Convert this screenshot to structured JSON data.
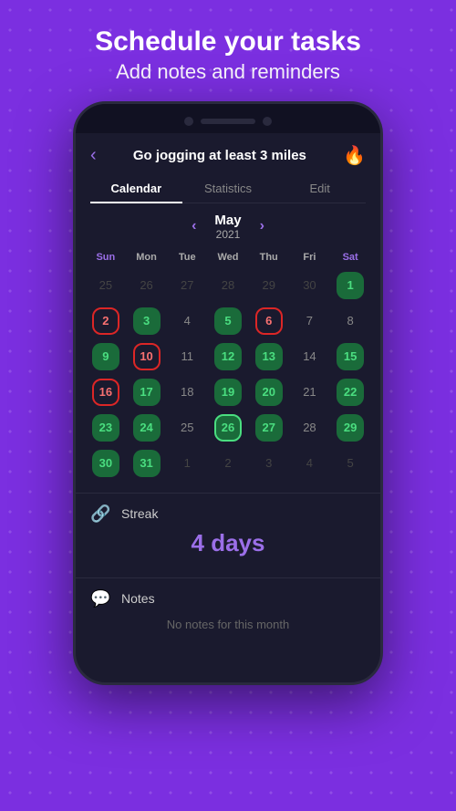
{
  "hero": {
    "title": "Schedule your tasks",
    "subtitle": "Add notes and reminders"
  },
  "phone": {
    "header": {
      "back_icon": "‹",
      "title": "Go jogging at least 3 miles",
      "fire_icon": "🔥"
    },
    "tabs": [
      {
        "label": "Calendar",
        "active": true
      },
      {
        "label": "Statistics",
        "active": false
      },
      {
        "label": "Edit",
        "active": false
      }
    ],
    "calendar": {
      "nav_prev": "‹",
      "nav_next": "›",
      "month": "May",
      "year": "2021",
      "day_headers": [
        {
          "label": "Sun",
          "type": "sun"
        },
        {
          "label": "Mon",
          "type": "weekday"
        },
        {
          "label": "Tue",
          "type": "weekday"
        },
        {
          "label": "Wed",
          "type": "weekday"
        },
        {
          "label": "Thu",
          "type": "weekday"
        },
        {
          "label": "Fri",
          "type": "weekday"
        },
        {
          "label": "Sat",
          "type": "sat"
        }
      ],
      "weeks": [
        [
          {
            "num": "25",
            "type": "other-month"
          },
          {
            "num": "26",
            "type": "other-month"
          },
          {
            "num": "27",
            "type": "other-month"
          },
          {
            "num": "28",
            "type": "other-month"
          },
          {
            "num": "29",
            "type": "other-month"
          },
          {
            "num": "30",
            "type": "other-month"
          },
          {
            "num": "1",
            "type": "green"
          }
        ],
        [
          {
            "num": "2",
            "type": "red"
          },
          {
            "num": "3",
            "type": "green"
          },
          {
            "num": "4",
            "type": "plain"
          },
          {
            "num": "5",
            "type": "green"
          },
          {
            "num": "6",
            "type": "red"
          },
          {
            "num": "7",
            "type": "plain"
          },
          {
            "num": "8",
            "type": "plain"
          }
        ],
        [
          {
            "num": "9",
            "type": "green"
          },
          {
            "num": "10",
            "type": "red"
          },
          {
            "num": "11",
            "type": "plain"
          },
          {
            "num": "12",
            "type": "green"
          },
          {
            "num": "13",
            "type": "green"
          },
          {
            "num": "14",
            "type": "plain"
          },
          {
            "num": "15",
            "type": "green"
          }
        ],
        [
          {
            "num": "16",
            "type": "red"
          },
          {
            "num": "17",
            "type": "green"
          },
          {
            "num": "18",
            "type": "plain"
          },
          {
            "num": "19",
            "type": "green"
          },
          {
            "num": "20",
            "type": "green"
          },
          {
            "num": "21",
            "type": "plain"
          },
          {
            "num": "22",
            "type": "green"
          }
        ],
        [
          {
            "num": "23",
            "type": "green"
          },
          {
            "num": "24",
            "type": "green"
          },
          {
            "num": "25",
            "type": "plain"
          },
          {
            "num": "26",
            "type": "today-green"
          },
          {
            "num": "27",
            "type": "green"
          },
          {
            "num": "28",
            "type": "plain"
          },
          {
            "num": "29",
            "type": "green"
          }
        ],
        [
          {
            "num": "30",
            "type": "green"
          },
          {
            "num": "31",
            "type": "green"
          },
          {
            "num": "1",
            "type": "other-month"
          },
          {
            "num": "2",
            "type": "other-month"
          },
          {
            "num": "3",
            "type": "other-month"
          },
          {
            "num": "4",
            "type": "other-month"
          },
          {
            "num": "5",
            "type": "other-month"
          }
        ]
      ]
    },
    "streak": {
      "icon": "🔗",
      "label": "Streak",
      "value": "4 days"
    },
    "notes": {
      "icon": "💬",
      "label": "Notes",
      "empty_text": "No notes for this month"
    }
  }
}
